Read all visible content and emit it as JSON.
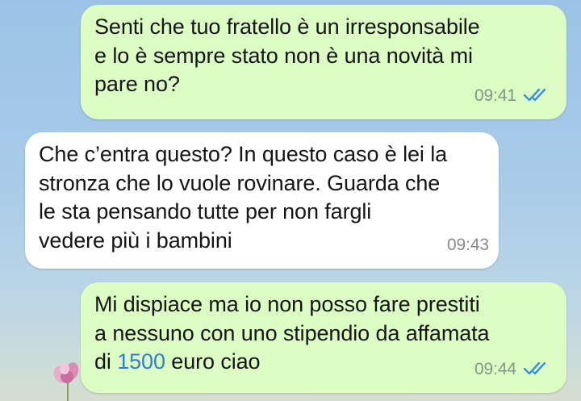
{
  "messages": [
    {
      "direction": "out",
      "text": "Senti che tuo fratello è un irresponsabile\ne lo è sempre stato non è una novità mi\npare no?",
      "time": "09:41",
      "status": "read",
      "status_icon": "double-check-icon"
    },
    {
      "direction": "in",
      "text": "Che c’entra questo? In questo caso è lei la\nstronza che lo vuole rovinare. Guarda che\nle sta pensando tutte per non fargli\nvedere più i bambini",
      "time": "09:43"
    },
    {
      "direction": "out",
      "text_before": "Mi dispiace ma io non posso fare prestiti\na nessuno con uno stipendio da affamata\ndi ",
      "text_link": "1500",
      "text_after": " euro ciao",
      "time": "09:44",
      "status": "read",
      "status_icon": "double-check-icon"
    }
  ],
  "colors": {
    "outgoing_bubble": "#dcfec5",
    "incoming_bubble": "#ffffff",
    "read_ticks": "#3b8fe0",
    "number_link": "#2f7fd0"
  }
}
